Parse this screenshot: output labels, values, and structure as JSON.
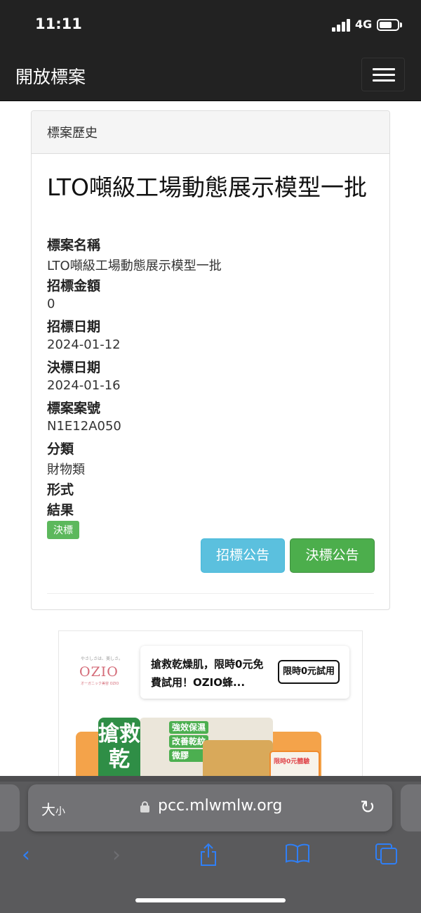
{
  "status_bar": {
    "time": "11:11",
    "network": "4G"
  },
  "navbar": {
    "brand": "開放標案"
  },
  "panel": {
    "heading": "標案歷史",
    "title": "LTO噸級工場動態展示模型一批",
    "fields": [
      {
        "label": "標案名稱",
        "value": "LTO噸級工場動態展示模型一批"
      },
      {
        "label": "招標金額",
        "value": "0"
      },
      {
        "label": "招標日期",
        "value": "2024-01-12"
      },
      {
        "label": "決標日期",
        "value": "2024-01-16"
      },
      {
        "label": "標案案號",
        "value": "N1E12A050"
      },
      {
        "label": "分類",
        "value": "財物類"
      },
      {
        "label": "形式",
        "value": ""
      },
      {
        "label": "結果",
        "value": ""
      }
    ],
    "result_badge": "決標",
    "buttons": {
      "tender_notice": "招標公告",
      "award_notice": "決標公告"
    }
  },
  "ad": {
    "logo": "OZIO",
    "logo_tagline": "やさしさは、美しさ。",
    "logo_sub": "オーガニック美容 OZIO",
    "headline": "搶救乾燥肌，限時0元免費試用！OZIO蜂...",
    "cta": "限時0元試用",
    "product_label": "搶救乾",
    "product_chips": [
      "強效保濕",
      "改善乾紋",
      "微膠"
    ],
    "card_label": "限時0元體驗"
  },
  "safari": {
    "text_size": "大",
    "text_size_small": "小",
    "url": "pcc.mlwmlw.org"
  }
}
